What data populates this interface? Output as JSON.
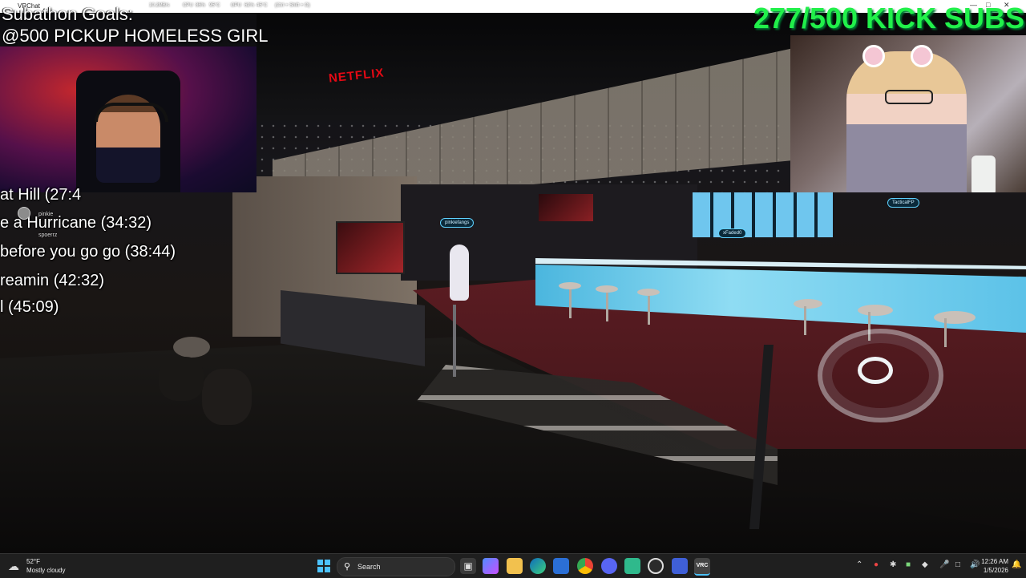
{
  "window": {
    "title": "VRChat"
  },
  "perf": {
    "net": "10.2MB/s",
    "cpu_label": "CPU",
    "cpu": "86%",
    "cpu_temp": "95°C",
    "gpu_label": "GPU",
    "gpu": "62%",
    "gpu_temp": "45°C",
    "hotkey": "(Ctrl + Shift + O)"
  },
  "overlay": {
    "goals_title": "Subathon Goals:",
    "goal_item": "@500 PICKUP HOMELESS GIRL",
    "subs_counter": "277/500 KICK SUBS"
  },
  "playlist": [
    "at Hill (27:4",
    "e a Hurricane (34:32)",
    "before you go go (38:44)",
    "reamin (42:32)",
    "l (45:09)"
  ],
  "chat": [
    {
      "user": "pinkie"
    },
    {
      "user": "spoerrz"
    }
  ],
  "scene": {
    "netflix_sign": "NETFLIX",
    "nametags": [
      "pinkiefangs",
      "xFaded0",
      "TacticalFP"
    ]
  },
  "taskbar": {
    "weather_temp": "52°F",
    "weather_cond": "Mostly cloudy",
    "search_label": "Search",
    "apps": [
      "file-explorer",
      "copilot",
      "folder",
      "edge",
      "store",
      "chrome",
      "discord",
      "app",
      "obs",
      "twitch-app",
      "vrchat"
    ],
    "time": "12:26 AM",
    "date": "1/5/2026"
  },
  "colors": {
    "subs_green": "#21f04a",
    "taskbar": "#1f1f1f",
    "accent": "#4cc2ff"
  }
}
